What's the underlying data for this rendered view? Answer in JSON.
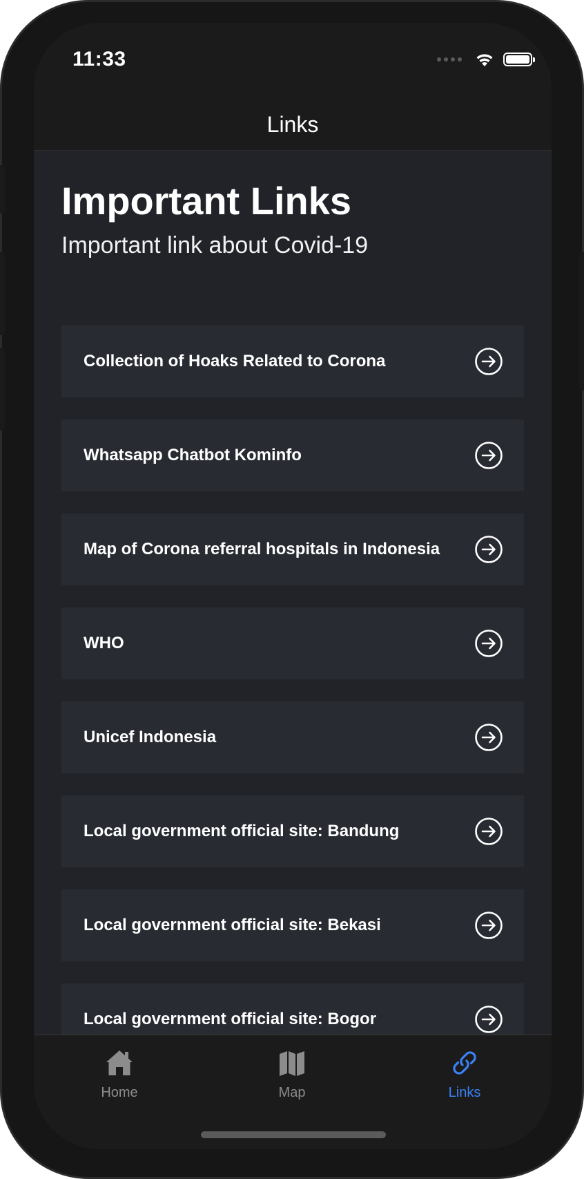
{
  "status_bar": {
    "time": "11:33"
  },
  "nav": {
    "title": "Links"
  },
  "header": {
    "title": "Important Links",
    "subtitle": "Important link about Covid-19"
  },
  "links": [
    {
      "label": "Collection of Hoaks Related to Corona",
      "icon": "arrow-right-circle-icon"
    },
    {
      "label": "Whatsapp Chatbot Kominfo",
      "icon": "arrow-right-circle-icon"
    },
    {
      "label": "Map of Corona referral hospitals in Indonesia",
      "icon": "arrow-right-circle-icon"
    },
    {
      "label": "WHO",
      "icon": "arrow-right-circle-icon"
    },
    {
      "label": "Unicef Indonesia",
      "icon": "arrow-right-circle-icon"
    },
    {
      "label": "Local government official site: Bandung",
      "icon": "arrow-right-circle-icon"
    },
    {
      "label": "Local government official site: Bekasi",
      "icon": "arrow-right-circle-icon"
    },
    {
      "label": "Local government official site: Bogor",
      "icon": "arrow-right-circle-icon"
    }
  ],
  "tabs": [
    {
      "label": "Home",
      "icon": "home-icon",
      "active": false
    },
    {
      "label": "Map",
      "icon": "map-icon",
      "active": false
    },
    {
      "label": "Links",
      "icon": "link-icon",
      "active": true
    }
  ],
  "colors": {
    "background": "#1b1b1b",
    "content_background": "#212328",
    "card_background": "#282b31",
    "text": "#ffffff",
    "active_tab": "#3b82f6",
    "inactive_tab": "#8c8c8c"
  }
}
